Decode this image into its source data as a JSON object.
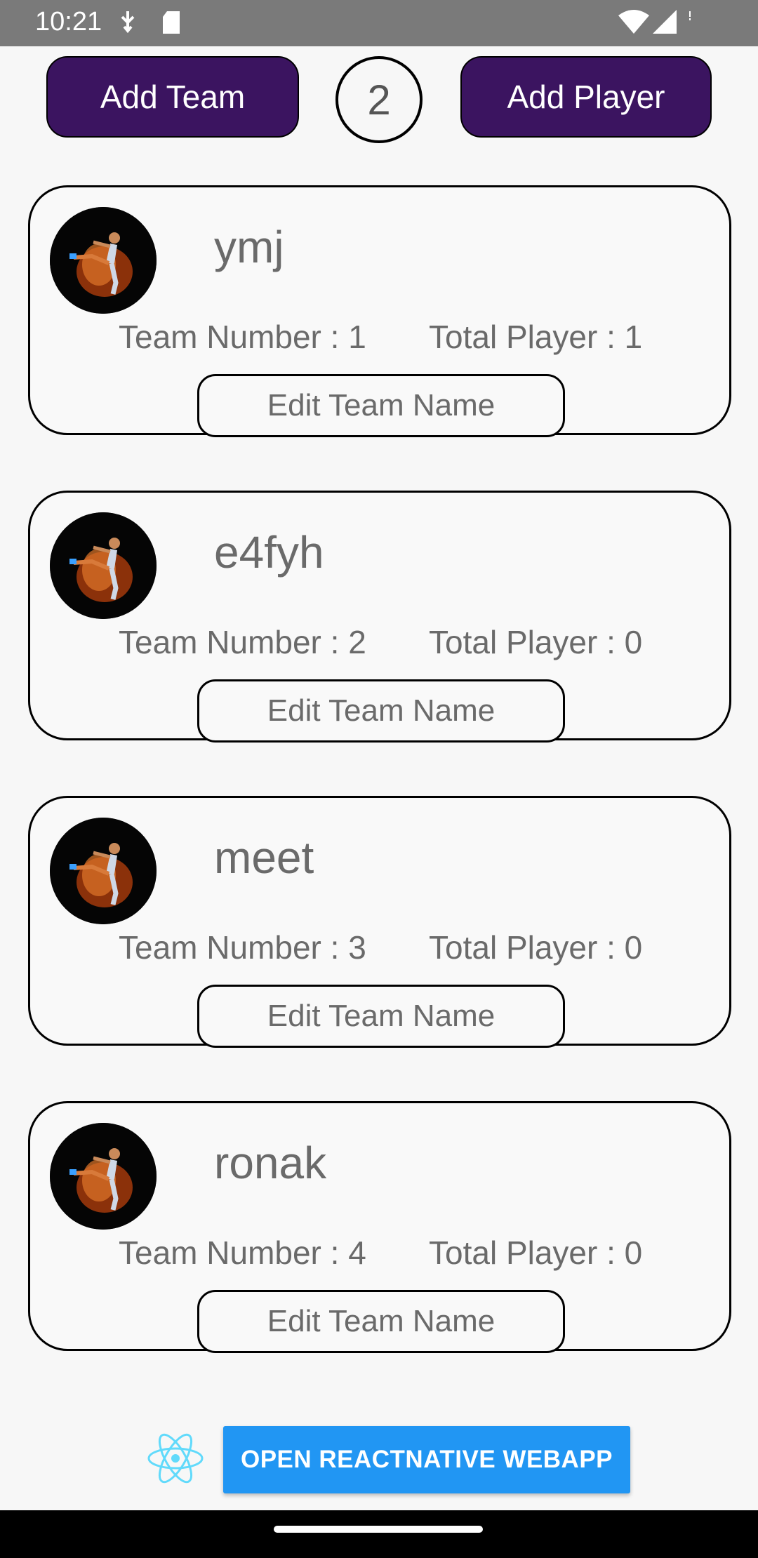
{
  "status_bar": {
    "time": "10:21",
    "icons": [
      "usb-debug-icon",
      "sd-card-icon",
      "wifi-icon",
      "signal-icon"
    ]
  },
  "header": {
    "add_team_label": "Add Team",
    "team_count": "2",
    "add_player_label": "Add Player"
  },
  "teams": [
    {
      "name": "ymj",
      "number_text": "Team Number : 1",
      "total_text": "Total Player : 1",
      "edit_label": "Edit Team Name"
    },
    {
      "name": "e4fyh",
      "number_text": "Team Number : 2",
      "total_text": "Total Player : 0",
      "edit_label": "Edit Team Name"
    },
    {
      "name": "meet",
      "number_text": "Team Number : 3",
      "total_text": "Total Player : 0",
      "edit_label": "Edit Team Name"
    },
    {
      "name": "ronak",
      "number_text": "Team Number : 4",
      "total_text": "Total Player : 0",
      "edit_label": "Edit Team Name"
    }
  ],
  "footer": {
    "open_webapp_label": "OPEN REACTNATIVE WEBAPP",
    "icon": "react-logo-icon"
  },
  "colors": {
    "primary_button": "#3b1460",
    "accent_blue": "#2196f3",
    "status_bar": "#7a7a7a"
  }
}
